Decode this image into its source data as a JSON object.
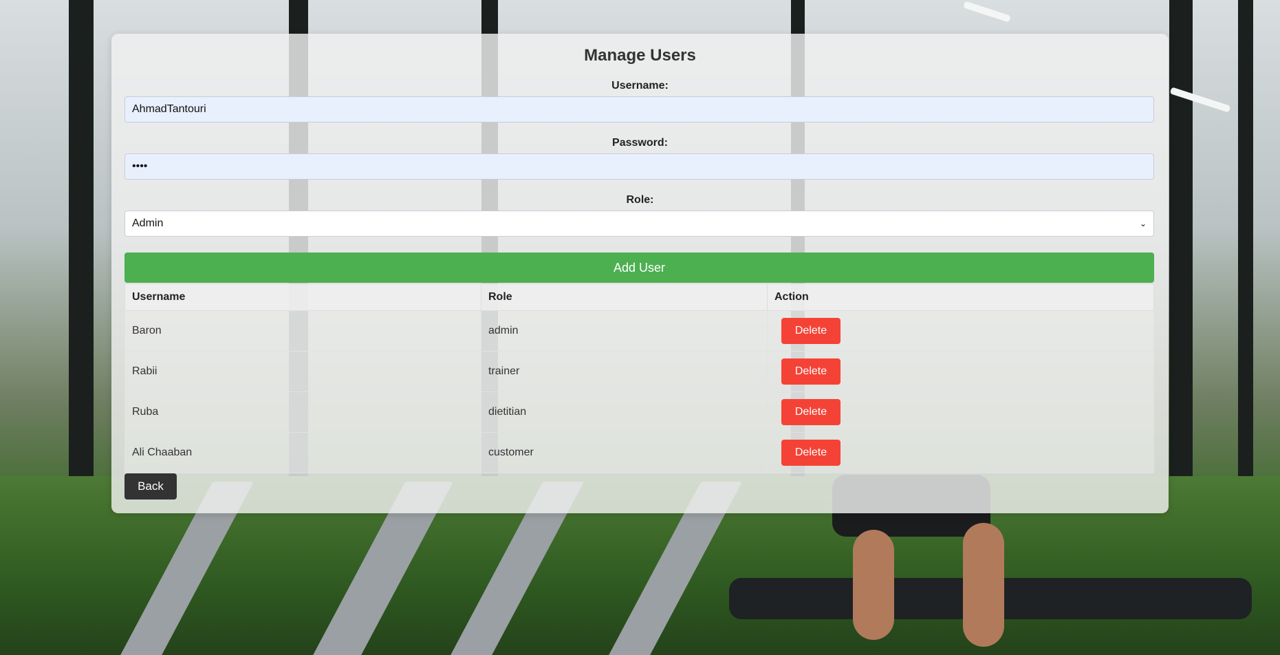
{
  "page": {
    "title": "Manage Users"
  },
  "form": {
    "username_label": "Username:",
    "username_value": "AhmadTantouri",
    "password_label": "Password:",
    "password_value": "••••",
    "role_label": "Role:",
    "role_selected": "Admin",
    "add_button": "Add User"
  },
  "table": {
    "headers": [
      "Username",
      "Role",
      "Action"
    ],
    "rows": [
      {
        "username": "Baron",
        "role": "admin",
        "action": "Delete"
      },
      {
        "username": "Rabii",
        "role": "trainer",
        "action": "Delete"
      },
      {
        "username": "Ruba",
        "role": "dietitian",
        "action": "Delete"
      },
      {
        "username": "Ali Chaaban",
        "role": "customer",
        "action": "Delete"
      }
    ]
  },
  "back_button": "Back",
  "colors": {
    "add_button": "#4caf50",
    "delete_button": "#f44336",
    "back_button": "#333333",
    "input_fill": "#e8f0fe"
  },
  "icons": {
    "select_arrow": "chevron-down-icon"
  }
}
